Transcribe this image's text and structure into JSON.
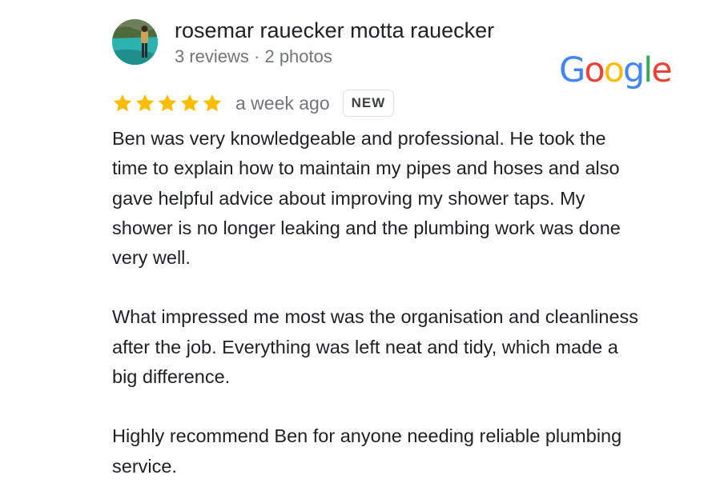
{
  "reviewer": {
    "name": "rosemar rauecker motta rauecker",
    "meta": "3 reviews · 2 photos"
  },
  "brand": {
    "letters": [
      "G",
      "o",
      "o",
      "g",
      "l",
      "e"
    ],
    "letter_colors": [
      "#4285F4",
      "#EA4335",
      "#FBBC05",
      "#4285F4",
      "#34A853",
      "#EA4335"
    ]
  },
  "review": {
    "rating": 5,
    "max_rating": 5,
    "star_color": "#FBBC04",
    "relative_time": "a week ago",
    "badge": "NEW",
    "paragraphs": [
      "Ben was very knowledgeable and professional. He took the time to explain how to maintain my pipes and hoses and also gave helpful advice about improving my shower taps. My shower is no longer leaking and the plumbing work was done very well.",
      "What impressed me most was the organisation and cleanliness after the job. Everything was left neat and tidy, which made a big difference.",
      "Highly recommend Ben for anyone needing reliable plumbing service."
    ]
  }
}
